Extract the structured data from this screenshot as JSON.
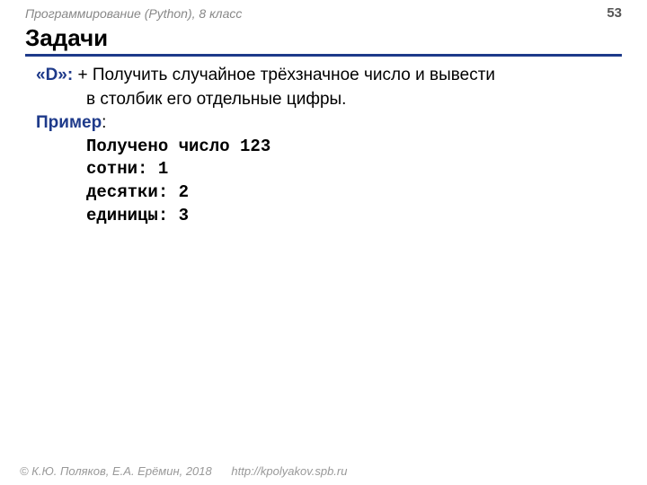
{
  "header": {
    "subject": "Программирование (Python), 8 класс",
    "page_number": "53"
  },
  "title": "Задачи",
  "task": {
    "label": "«D»:",
    "text_line1": " + Получить случайное трёхзначное число и вывести",
    "text_line2": "в столбик его отдельные цифры."
  },
  "example": {
    "label": "Пример",
    "colon": ":",
    "lines": [
      "Получено число 123",
      "сотни: 1",
      "десятки: 2",
      "единицы: 3"
    ]
  },
  "footer": {
    "copyright": "© К.Ю. Поляков, Е.А. Ерёмин, 2018",
    "url": "http://kpolyakov.spb.ru"
  }
}
